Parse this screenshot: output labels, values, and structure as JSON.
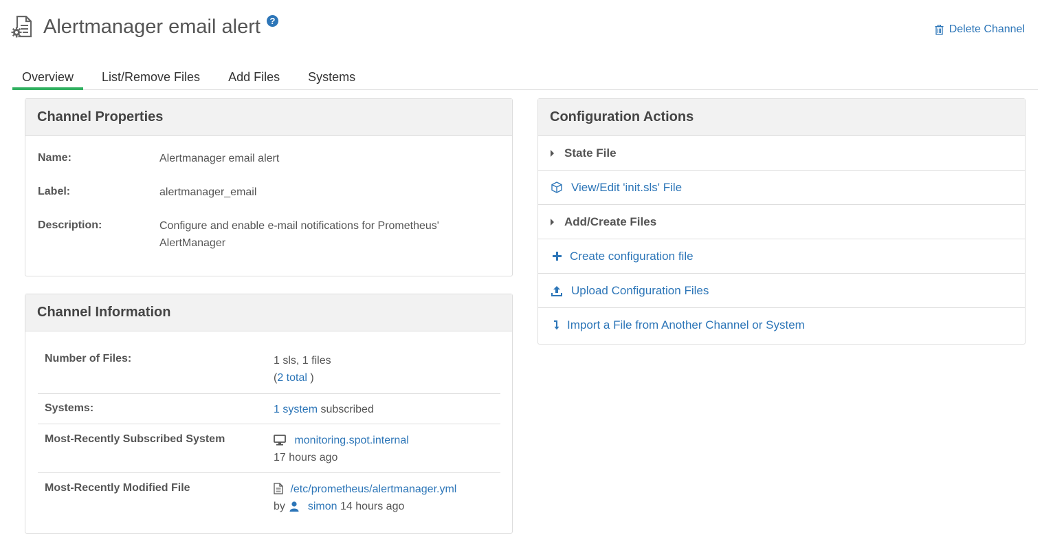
{
  "header": {
    "title": "Alertmanager email alert",
    "help_icon": "question-circle-icon",
    "delete_label": "Delete Channel"
  },
  "tabs": [
    {
      "label": "Overview",
      "active": true
    },
    {
      "label": "List/Remove Files"
    },
    {
      "label": "Add Files"
    },
    {
      "label": "Systems"
    }
  ],
  "properties": {
    "heading": "Channel Properties",
    "name_label": "Name:",
    "name_value": "Alertmanager email alert",
    "label_label": "Label:",
    "label_value": "alertmanager_email",
    "description_label": "Description:",
    "description_value": "Configure and enable e-mail notifications for Prometheus' AlertManager"
  },
  "info": {
    "heading": "Channel Information",
    "files_label": "Number of Files:",
    "files_value": "1 sls, 1 files",
    "files_total_open": "(",
    "files_total_link": "2 total",
    "files_total_close": " )",
    "systems_label": "Systems:",
    "systems_link": "1 system",
    "systems_suffix": " subscribed",
    "recent_system_label": "Most-Recently Subscribed System",
    "recent_system_link": "monitoring.spot.internal",
    "recent_system_time": "17 hours ago",
    "recent_file_label": "Most-Recently Modified File",
    "recent_file_link": "/etc/prometheus/alertmanager.yml",
    "recent_file_by": "by",
    "recent_file_user": "simon",
    "recent_file_time": "14 hours ago"
  },
  "actions": {
    "heading": "Configuration Actions",
    "state_file_group": "State File",
    "view_edit": "View/Edit 'init.sls' File",
    "add_create_group": "Add/Create Files",
    "create_config": "Create configuration file",
    "upload_config": "Upload Configuration Files",
    "import_file": "Import a File from Another Channel or System"
  },
  "colors": {
    "link": "#2d76b8",
    "active_tab": "#30b060",
    "panel_heading_bg": "#f2f2f2"
  }
}
